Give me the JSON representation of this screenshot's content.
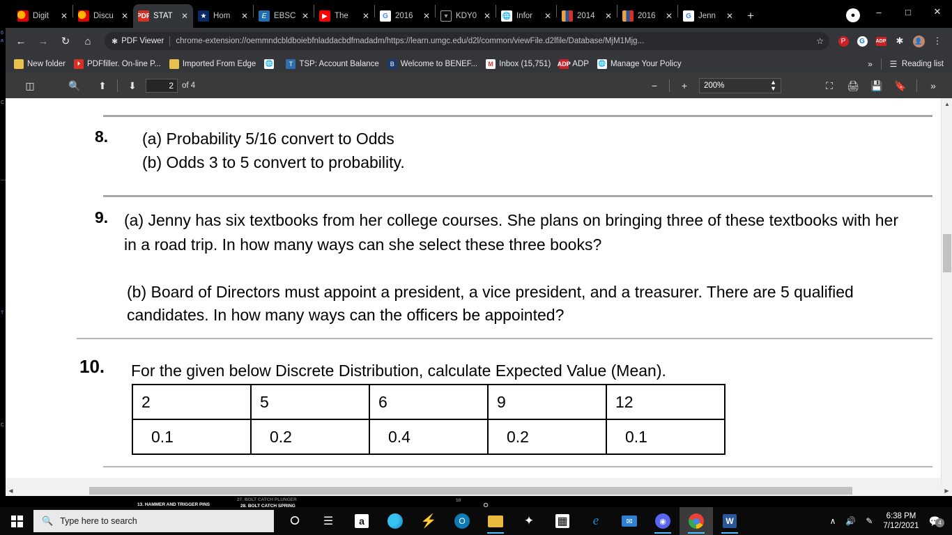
{
  "window": {
    "controls": {
      "minimize": "–",
      "maximize": "□",
      "close": "✕"
    },
    "profile_icon": "profile-avatar"
  },
  "tabs": [
    {
      "title": "Digit",
      "favicon": "umuc-u-icon",
      "active": false,
      "close": "✕"
    },
    {
      "title": "Discu",
      "favicon": "umuc-u-icon",
      "active": false,
      "close": "✕"
    },
    {
      "title": "STAT",
      "favicon": "pdf-doc-icon",
      "active": true,
      "close": "✕"
    },
    {
      "title": "Hom",
      "favicon": "star-blue-icon",
      "active": false,
      "close": "✕"
    },
    {
      "title": "EBSC",
      "favicon": "ebsco-icon",
      "active": false,
      "close": "✕"
    },
    {
      "title": "The ",
      "favicon": "youtube-icon",
      "active": false,
      "close": "✕"
    },
    {
      "title": "2016",
      "favicon": "google-icon",
      "active": false,
      "close": "✕"
    },
    {
      "title": "KDY0",
      "favicon": "circle-icon",
      "active": false,
      "close": "✕"
    },
    {
      "title": "Infor",
      "favicon": "globe-icon",
      "active": false,
      "close": "✕"
    },
    {
      "title": "2014",
      "favicon": "books-icon",
      "active": false,
      "close": "✕"
    },
    {
      "title": "2016",
      "favicon": "books-icon",
      "active": false,
      "close": "✕"
    },
    {
      "title": "Jenn",
      "favicon": "google-icon",
      "active": false,
      "close": "✕"
    }
  ],
  "new_tab_label": "+",
  "toolbar": {
    "back": "←",
    "forward": "→",
    "reload": "↻",
    "home": "⌂",
    "extension_name": "PDF Viewer",
    "url": "chrome-extension://oemmndcbldboiebfnladdacbdfmadadm/https://learn.umgc.edu/d2l/common/viewFile.d2lfile/Database/MjM1Mjg...",
    "bookmark_star": "☆",
    "right_icons": [
      "pinterest-icon",
      "google-icon",
      "adp-icon",
      "extensions-icon",
      "avatar-icon",
      "more-menu-icon"
    ],
    "more_menu": "⋮"
  },
  "bookmarks": {
    "items": [
      {
        "label": "New folder",
        "icon": "folder-icon"
      },
      {
        "label": "PDFfiller. On-line P...",
        "icon": "pdffiller-icon"
      },
      {
        "label": "Imported From Edge",
        "icon": "folder-icon"
      },
      {
        "label": "",
        "icon": "globe-icon"
      },
      {
        "label": "TSP: Account Balance",
        "icon": "tsp-icon"
      },
      {
        "label": "Welcome to BENEF...",
        "icon": "benefits-icon"
      },
      {
        "label": "Inbox (15,751)",
        "icon": "gmail-icon"
      },
      {
        "label": "ADP",
        "icon": "adp-icon"
      },
      {
        "label": "Manage Your Policy",
        "icon": "globe-icon"
      }
    ],
    "overflow": "»",
    "reading_list": "Reading list",
    "reading_list_icon": "reading-list-icon"
  },
  "pdf_toolbar": {
    "sidebar_icon": "sidebar-toggle-icon",
    "search_icon": "search-icon",
    "prev_page_icon": "up-arrow-icon",
    "next_page_icon": "down-arrow-icon",
    "page_value": "2",
    "page_total": "of 4",
    "zoom_out": "−",
    "zoom_in": "+",
    "zoom_value": "200%",
    "fit_icon": "fit-page-icon",
    "print_icon": "print-icon",
    "download_icon": "download-icon",
    "bookmark_icon": "bookmark-icon",
    "more_icon": "»"
  },
  "document": {
    "q8": {
      "number": "8.",
      "line_a": "(a)  Probability  5/16  convert to Odds",
      "line_b": "(b)   Odds  3 to 5 convert to probability."
    },
    "q9": {
      "number": "9.",
      "part_a": "(a)     Jenny has six textbooks from her college courses. She plans on bringing three of these textbooks with her in a road trip. In how many ways can she select these three books?",
      "part_b": "(b)   Board of Directors  must appoint a president, a vice president, and a treasurer. There are 5 qualified candidates. In how many ways can the officers be appointed?"
    },
    "q10": {
      "number": "10.",
      "prompt": "For the given below Discrete Distribution, calculate Expected Value (Mean).",
      "table": {
        "values": [
          "2",
          "5",
          "6",
          "9",
          "12"
        ],
        "probabilities": [
          "0.1",
          "0.2",
          "0.4",
          "0.2",
          "0.1"
        ]
      }
    }
  },
  "background_doc": {
    "line1": "13. HAMMER AND TRIGGER PINS",
    "line2": "27. BOLT CATCH PLUNGER",
    "line3": "28. BOLT CATCH SPRING",
    "line4": "10"
  },
  "taskbar": {
    "start_icon": "windows-start-icon",
    "search_placeholder": "Type here to search",
    "search_icon": "search-icon",
    "apps": [
      {
        "name": "cortana-icon",
        "active": false
      },
      {
        "name": "task-view-icon",
        "active": false
      },
      {
        "name": "amazon-icon",
        "active": false
      },
      {
        "name": "edge-icon",
        "active": false
      },
      {
        "name": "bolt-icon",
        "active": false
      },
      {
        "name": "opera-icon",
        "active": false
      },
      {
        "name": "file-explorer-icon",
        "active": true
      },
      {
        "name": "dropbox-icon",
        "active": false
      },
      {
        "name": "microsoft-store-icon",
        "active": false
      },
      {
        "name": "internet-explorer-icon",
        "active": false
      },
      {
        "name": "mail-icon",
        "active": false
      },
      {
        "name": "discord-icon",
        "active": true
      },
      {
        "name": "chrome-icon",
        "active": true
      },
      {
        "name": "word-icon",
        "active": true
      }
    ],
    "tray": {
      "chevron": "∧",
      "volume": "volume-icon",
      "pen": "pen-icon",
      "time": "6:38 PM",
      "date": "7/12/2021",
      "notification_icon": "notification-icon",
      "notification_count": "4"
    }
  },
  "sliver": {
    "l1": "6",
    "l2": "a",
    "l3": "C",
    "l4": "—",
    "l5": "T",
    "l6": "C"
  }
}
